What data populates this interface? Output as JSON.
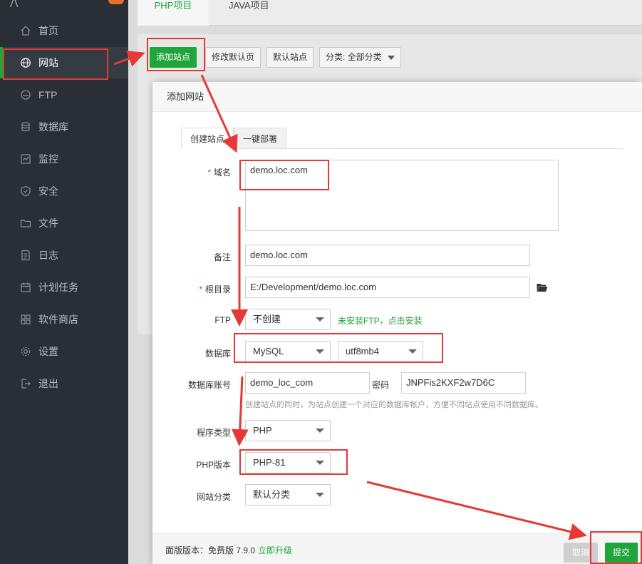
{
  "sidebar": {
    "items": [
      {
        "label": "首页",
        "icon": "home-icon"
      },
      {
        "label": "网站",
        "icon": "globe-icon"
      },
      {
        "label": "FTP",
        "icon": "ftp-icon"
      },
      {
        "label": "数据库",
        "icon": "database-icon"
      },
      {
        "label": "监控",
        "icon": "monitor-icon"
      },
      {
        "label": "安全",
        "icon": "shield-icon"
      },
      {
        "label": "文件",
        "icon": "folder-icon"
      },
      {
        "label": "日志",
        "icon": "log-icon"
      },
      {
        "label": "计划任务",
        "icon": "calendar-icon"
      },
      {
        "label": "软件商店",
        "icon": "apps-icon"
      },
      {
        "label": "设置",
        "icon": "gear-icon"
      },
      {
        "label": "退出",
        "icon": "logout-icon"
      }
    ],
    "active": "网站"
  },
  "top_tabs": {
    "php": "PHP项目",
    "java": "JAVA项目"
  },
  "toolbar": {
    "add_site": "添加站点",
    "edit_default_page": "修改默认页",
    "default_site": "默认站点",
    "category": "分类: 全部分类"
  },
  "dialog": {
    "title": "添加网站",
    "tabs": {
      "create": "创建站点",
      "one_click": "一键部署"
    },
    "domain": {
      "label": "域名",
      "value": "demo.loc.com"
    },
    "remark": {
      "label": "备注",
      "value": "demo.loc.com"
    },
    "root_dir": {
      "label": "根目录",
      "value": "E:/Development/demo.loc.com"
    },
    "ftp": {
      "label": "FTP",
      "value": "不创建",
      "hint": "未安装FTP，点击安装"
    },
    "database": {
      "label": "数据库",
      "value": "MySQL",
      "charset": "utf8mb4"
    },
    "db_account": {
      "label": "数据库账号",
      "value": "demo_loc_com",
      "password_label": "密码",
      "password": "JNPFis2KXF2w7D6C",
      "hint": "创建站点的同时，为站点创建一个对应的数据库帐户，方便不同站点使用不同数据库。"
    },
    "program_type": {
      "label": "程序类型",
      "value": "PHP"
    },
    "php_version": {
      "label": "PHP版本",
      "value": "PHP-81"
    },
    "site_category": {
      "label": "网站分类",
      "value": "默认分类"
    },
    "footer": {
      "version_text": "面版版本：免费版 7.9.0",
      "upgrade": "立即升级",
      "cancel": "取消",
      "submit": "提交"
    }
  },
  "colors": {
    "sidebar_bg": "#2a2f35",
    "accent_green": "#20a53a",
    "annotation_red": "#e53935"
  }
}
